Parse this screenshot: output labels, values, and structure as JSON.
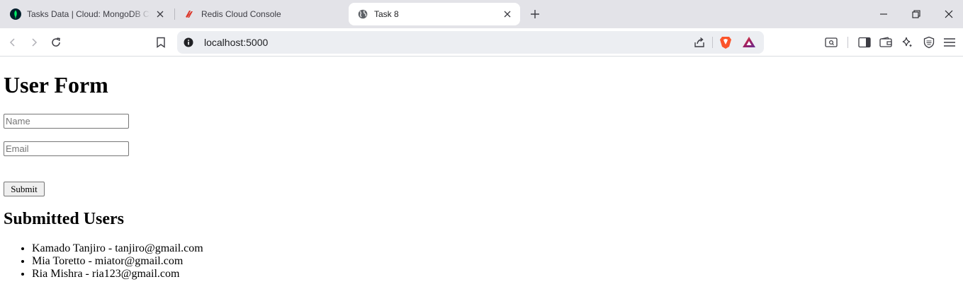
{
  "browser": {
    "tabs": [
      {
        "title": "Tasks Data | Cloud: MongoDB Cloud",
        "icon": "mongodb-leaf-icon",
        "active": false
      },
      {
        "title": "Redis Cloud Console",
        "icon": "redis-icon",
        "active": false
      },
      {
        "title": "Task 8",
        "icon": "globe-icon",
        "active": true
      }
    ],
    "url": "localhost:5000"
  },
  "form": {
    "heading": "User Form",
    "name_placeholder": "Name",
    "email_placeholder": "Email",
    "submit_label": "Submit"
  },
  "users": {
    "heading": "Submitted Users",
    "items": [
      "Kamado Tanjiro - tanjiro@gmail.com",
      "Mia Toretto - miator@gmail.com",
      "Ria Mishra - ria123@gmail.com"
    ]
  },
  "colors": {
    "tabstrip_bg": "#e3e3e8",
    "urlbar_bg": "#eceef2",
    "brave_orange": "#fb542b",
    "redis_red": "#dc382c",
    "mongodb_green": "#00ed64"
  }
}
